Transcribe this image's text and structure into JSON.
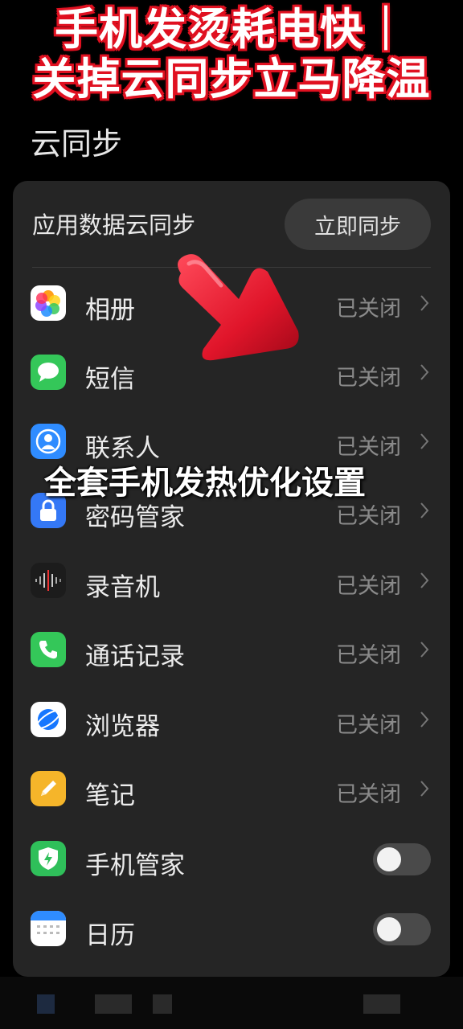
{
  "banner": {
    "line1": "手机发烫耗电快｜",
    "line2": "关掉云同步立马降温"
  },
  "page": {
    "title": "云同步"
  },
  "card": {
    "title": "应用数据云同步",
    "sync_button": "立即同步"
  },
  "items": [
    {
      "label": "相册",
      "status": "已关闭",
      "icon": "photos-icon"
    },
    {
      "label": "短信",
      "status": "已关闭",
      "icon": "messages-icon"
    },
    {
      "label": "联系人",
      "status": "已关闭",
      "icon": "contacts-icon"
    },
    {
      "label": "密码管家",
      "status": "已关闭",
      "icon": "lock-icon"
    },
    {
      "label": "录音机",
      "status": "已关闭",
      "icon": "recorder-icon"
    },
    {
      "label": "通话记录",
      "status": "已关闭",
      "icon": "phone-icon"
    },
    {
      "label": "浏览器",
      "status": "已关闭",
      "icon": "browser-icon"
    },
    {
      "label": "笔记",
      "status": "已关闭",
      "icon": "notes-icon"
    },
    {
      "label": "手机管家",
      "toggle": false,
      "icon": "phone-manager-icon"
    },
    {
      "label": "日历",
      "toggle": false,
      "icon": "calendar-icon"
    }
  ],
  "overlay": {
    "caption": "全套手机发热优化设置"
  },
  "colors": {
    "banner_outline": "#e01020",
    "arrow": "#e0152a",
    "card_bg": "#252525",
    "status_text": "#8a8a8a"
  }
}
